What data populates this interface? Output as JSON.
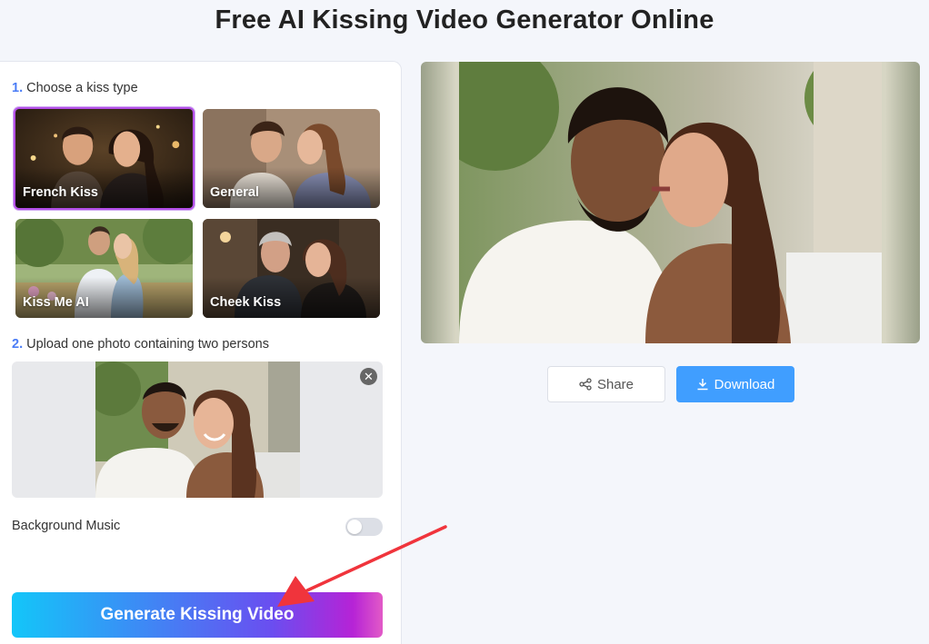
{
  "page": {
    "title": "Free AI Kissing Video Generator Online"
  },
  "step1": {
    "number": "1.",
    "label": "Choose a kiss type"
  },
  "kiss_types": [
    {
      "label": "French Kiss",
      "selected": true
    },
    {
      "label": "General",
      "selected": false
    },
    {
      "label": "Kiss Me AI",
      "selected": false
    },
    {
      "label": "Cheek Kiss",
      "selected": false
    }
  ],
  "step2": {
    "number": "2.",
    "label": "Upload one photo containing two persons"
  },
  "upload": {
    "remove_icon": "close-icon"
  },
  "music": {
    "label": "Background Music",
    "enabled": false
  },
  "generate": {
    "label": "Generate Kissing Video"
  },
  "actions": {
    "share_label": "Share",
    "download_label": "Download"
  },
  "colors": {
    "accent": "#409eff",
    "step_number": "#4a7cf6",
    "selected_border": "#b44fe8",
    "annotation_arrow": "#f0343c"
  }
}
